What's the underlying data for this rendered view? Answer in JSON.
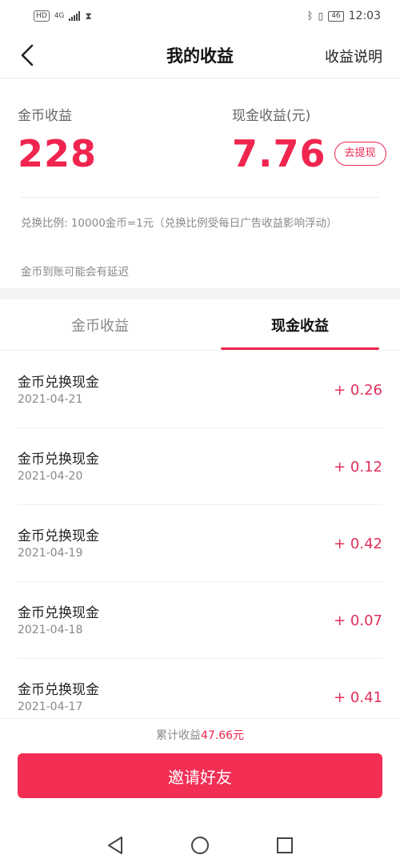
{
  "status_bar": {
    "hd": "HD",
    "network": "4G",
    "battery": "46",
    "time": "12:03"
  },
  "nav": {
    "title": "我的收益",
    "right_action": "收益说明"
  },
  "summary": {
    "coin_label": "金币收益",
    "coin_value": "228",
    "cash_label": "现金收益(元)",
    "cash_value": "7.76",
    "withdraw_label": "去提现",
    "note_ratio": "兑换比例: 10000金币=1元（兑换比例受每日广告收益影响浮动）",
    "note_delay": "金币到账可能会有延迟"
  },
  "tabs": [
    {
      "label": "金币收益",
      "active": false
    },
    {
      "label": "现金收益",
      "active": true
    }
  ],
  "records": [
    {
      "title": "金币兑换现金",
      "date": "2021-04-21",
      "amount": "+ 0.26"
    },
    {
      "title": "金币兑换现金",
      "date": "2021-04-20",
      "amount": "+ 0.12"
    },
    {
      "title": "金币兑换现金",
      "date": "2021-04-19",
      "amount": "+ 0.42"
    },
    {
      "title": "金币兑换现金",
      "date": "2021-04-18",
      "amount": "+ 0.07"
    },
    {
      "title": "金币兑换现金",
      "date": "2021-04-17",
      "amount": "+ 0.41"
    }
  ],
  "footer": {
    "total_prefix": "累计收益",
    "total_value": "47.66元",
    "invite_label": "邀请好友"
  },
  "icons": {
    "back": "chevron-left-icon",
    "sys_back": "triangle-back-icon",
    "sys_home": "circle-home-icon",
    "sys_recent": "square-recent-icon"
  },
  "colors": {
    "accent": "#f0254f",
    "amount": "#e0305a",
    "button": "#f22e55"
  }
}
